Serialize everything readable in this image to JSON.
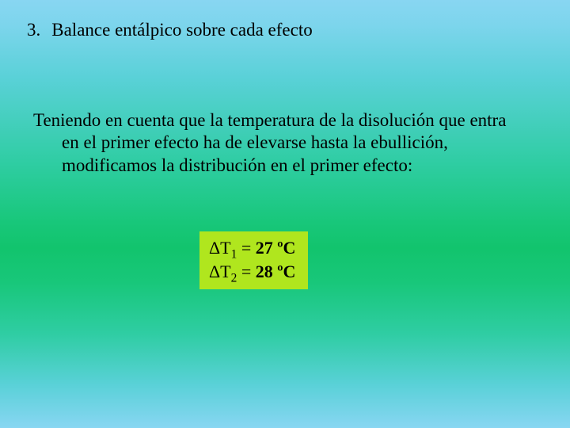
{
  "heading": {
    "number": "3.",
    "text": "Balance entálpico sobre cada efecto"
  },
  "paragraph": {
    "text": "Teniendo en cuenta que la temperatura de la disolución que entra en el primer efecto ha de elevarse hasta la ebullición, modificamos la distribución en el primer efecto:"
  },
  "equations": {
    "row1": {
      "delta": "Δ",
      "var": "T",
      "sub": "1",
      "eq": " = ",
      "value": "27",
      "unit": " ºC"
    },
    "row2": {
      "delta": "Δ",
      "var": "T",
      "sub": "2",
      "eq": " = ",
      "value": "28",
      "unit": " ºC"
    }
  }
}
